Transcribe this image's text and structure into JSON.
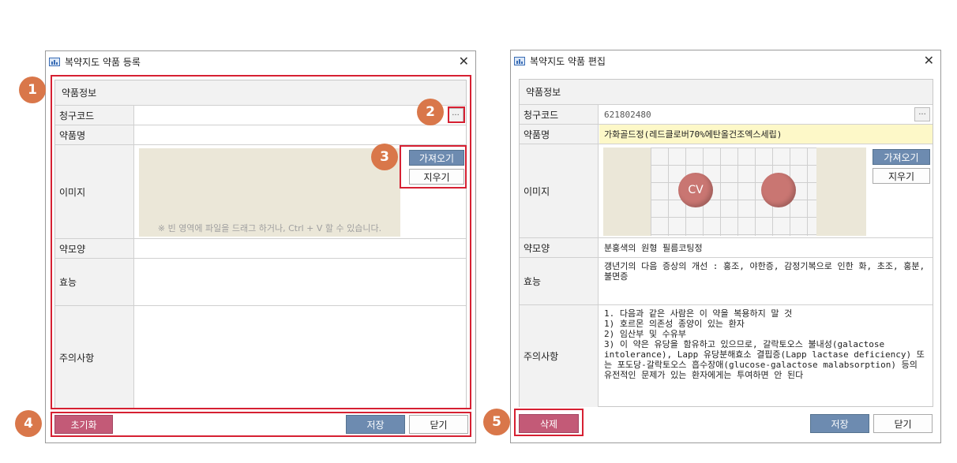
{
  "left": {
    "title": "복약지도 약품 등록",
    "section": "약품정보",
    "labels": {
      "code": "청구코드",
      "name": "약품명",
      "image": "이미지",
      "shape": "약모양",
      "effect": "효능",
      "caution": "주의사항"
    },
    "code_value": "",
    "drop_hint": "※ 빈 영역에 파일을 드래그 하거나, Ctrl + V 할 수 있습니다.",
    "buttons": {
      "dots": "···",
      "fetch": "가져오기",
      "clear": "지우기",
      "reset": "초기화",
      "save": "저장",
      "close": "닫기"
    }
  },
  "right": {
    "title": "복약지도 약품 편집",
    "section": "약품정보",
    "labels": {
      "code": "청구코드",
      "name": "약품명",
      "image": "이미지",
      "shape": "약모양",
      "effect": "효능",
      "caution": "주의사항"
    },
    "code_value": "621802480",
    "name_value": "가화골드정(레드클로버70%에탄올건조엑스세립)",
    "pill_imprint": "CV",
    "shape_value": "분홍색의 원형 필름코팅정",
    "effect_value": "갱년기의 다음 증상의 개선 : 홍조, 야한증, 감정기복으로 인한 화, 초조, 홍분, 불면증",
    "caution_value": "1. 다음과 같은 사람은 이 약을 복용하지 말 것\n1) 호르몬 의존성 종양이 있는 환자\n2) 임산부 및 수유부\n3) 이 약은 유당을 함유하고 있으므로, 갈락토오스 불내성(galactose intolerance), Lapp 유당분해효소 결핍증(Lapp lactase deficiency) 또는 포도당-갈락토오스 흡수장애(glucose-galactose malabsorption) 등의 유전적인 문제가 있는 환자에게는 투여하면 안 된다",
    "buttons": {
      "dots": "···",
      "fetch": "가져오기",
      "clear": "지우기",
      "delete": "삭제",
      "save": "저장",
      "close": "닫기"
    }
  },
  "badges": [
    "1",
    "2",
    "3",
    "4",
    "5"
  ],
  "colors": {
    "highlight": "#d62032",
    "badge": "#d9774a",
    "blue_button": "#6d8bb0",
    "red_button": "#c35a77",
    "name_highlight": "#fdf8c8"
  }
}
